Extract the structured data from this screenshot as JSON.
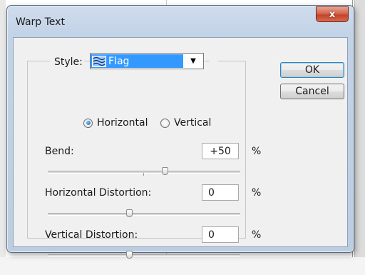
{
  "dialog": {
    "title": "Warp Text",
    "close_label": "x"
  },
  "style": {
    "label": "Style:",
    "selected": "Flag",
    "icon": "flag-warp-icon"
  },
  "orientation": {
    "horizontal_label": "Horizontal",
    "vertical_label": "Vertical",
    "selected": "Horizontal"
  },
  "bend": {
    "label": "Bend:",
    "value": "+50",
    "unit": "%",
    "level": 50
  },
  "horizontal_distortion": {
    "label": "Horizontal Distortion:",
    "value": "0",
    "unit": "%",
    "level": 0
  },
  "vertical_distortion": {
    "label": "Vertical Distortion:",
    "value": "0",
    "unit": "%",
    "level": 0
  },
  "buttons": {
    "ok": "OK",
    "cancel": "Cancel"
  },
  "colors": {
    "selection": "#3399ff",
    "close_button": "#c7462c"
  }
}
